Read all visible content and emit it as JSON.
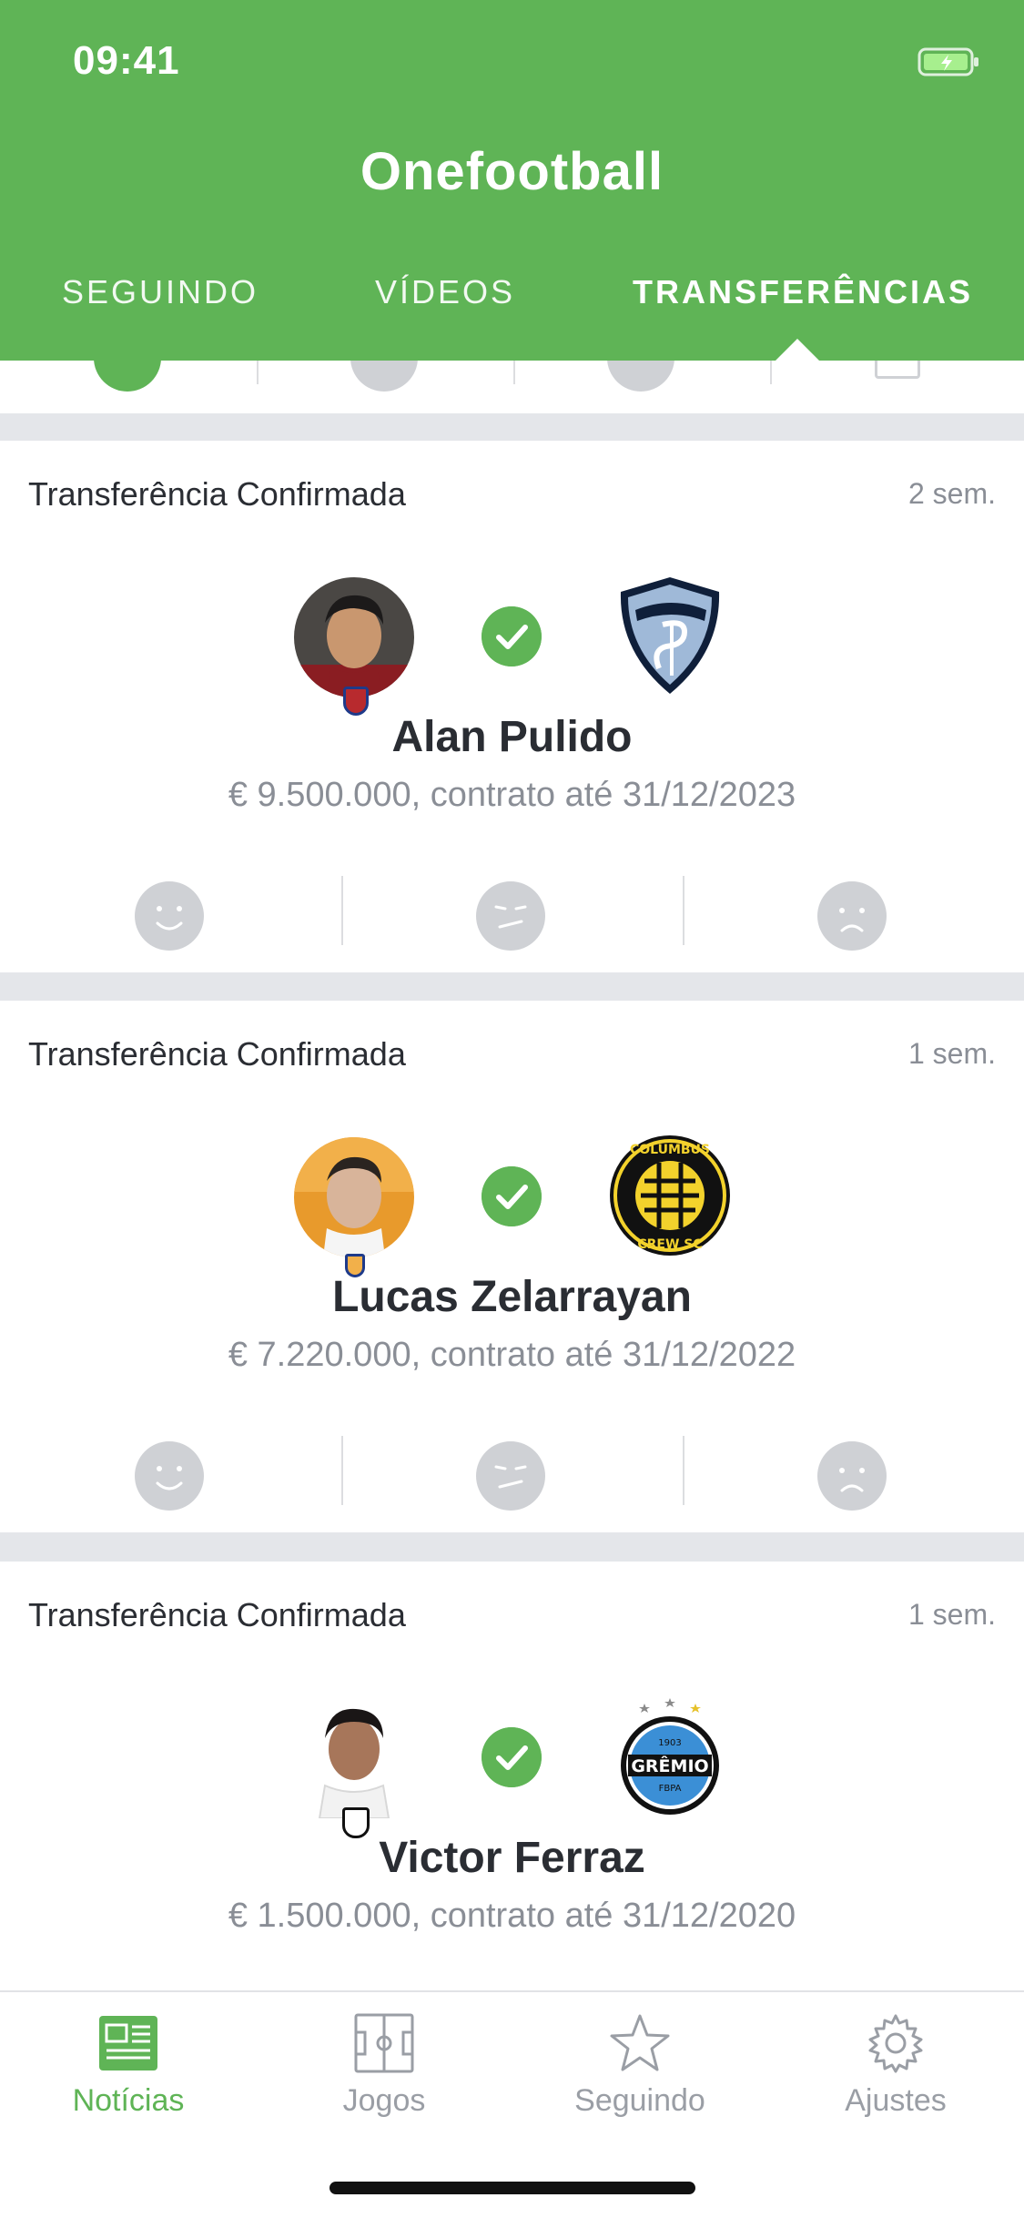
{
  "status": {
    "time": "09:41"
  },
  "app": {
    "title": "Onefootball"
  },
  "tabs": [
    {
      "label": "SEGUINDO"
    },
    {
      "label": "VÍDEOS"
    },
    {
      "label": "TRANSFERÊNCIAS"
    }
  ],
  "active_tab": "TRANSFERÊNCIAS",
  "cards": [
    {
      "title": "Transferência Confirmada",
      "time": "2 sem.",
      "player": "Alan Pulido",
      "info": "€ 9.500.000, contrato até 31/12/2023",
      "club_icon": "sporting-kc-crest-icon"
    },
    {
      "title": "Transferência Confirmada",
      "time": "1 sem.",
      "player": "Lucas Zelarrayan",
      "info": "€ 7.220.000, contrato até 31/12/2022",
      "club_icon": "columbus-crew-crest-icon"
    },
    {
      "title": "Transferência Confirmada",
      "time": "1 sem.",
      "player": "Victor Ferraz",
      "info": "€ 1.500.000, contrato até 31/12/2020",
      "club_icon": "gremio-crest-icon"
    }
  ],
  "nav": [
    {
      "label": "Notícias",
      "icon": "news-icon"
    },
    {
      "label": "Jogos",
      "icon": "pitch-icon"
    },
    {
      "label": "Seguindo",
      "icon": "star-icon"
    },
    {
      "label": "Ajustes",
      "icon": "gear-icon"
    }
  ],
  "colors": {
    "brand_green": "#5fb456",
    "text": "#2a2d33",
    "muted": "#8a8e96",
    "react_grey": "#cfd1d5"
  }
}
